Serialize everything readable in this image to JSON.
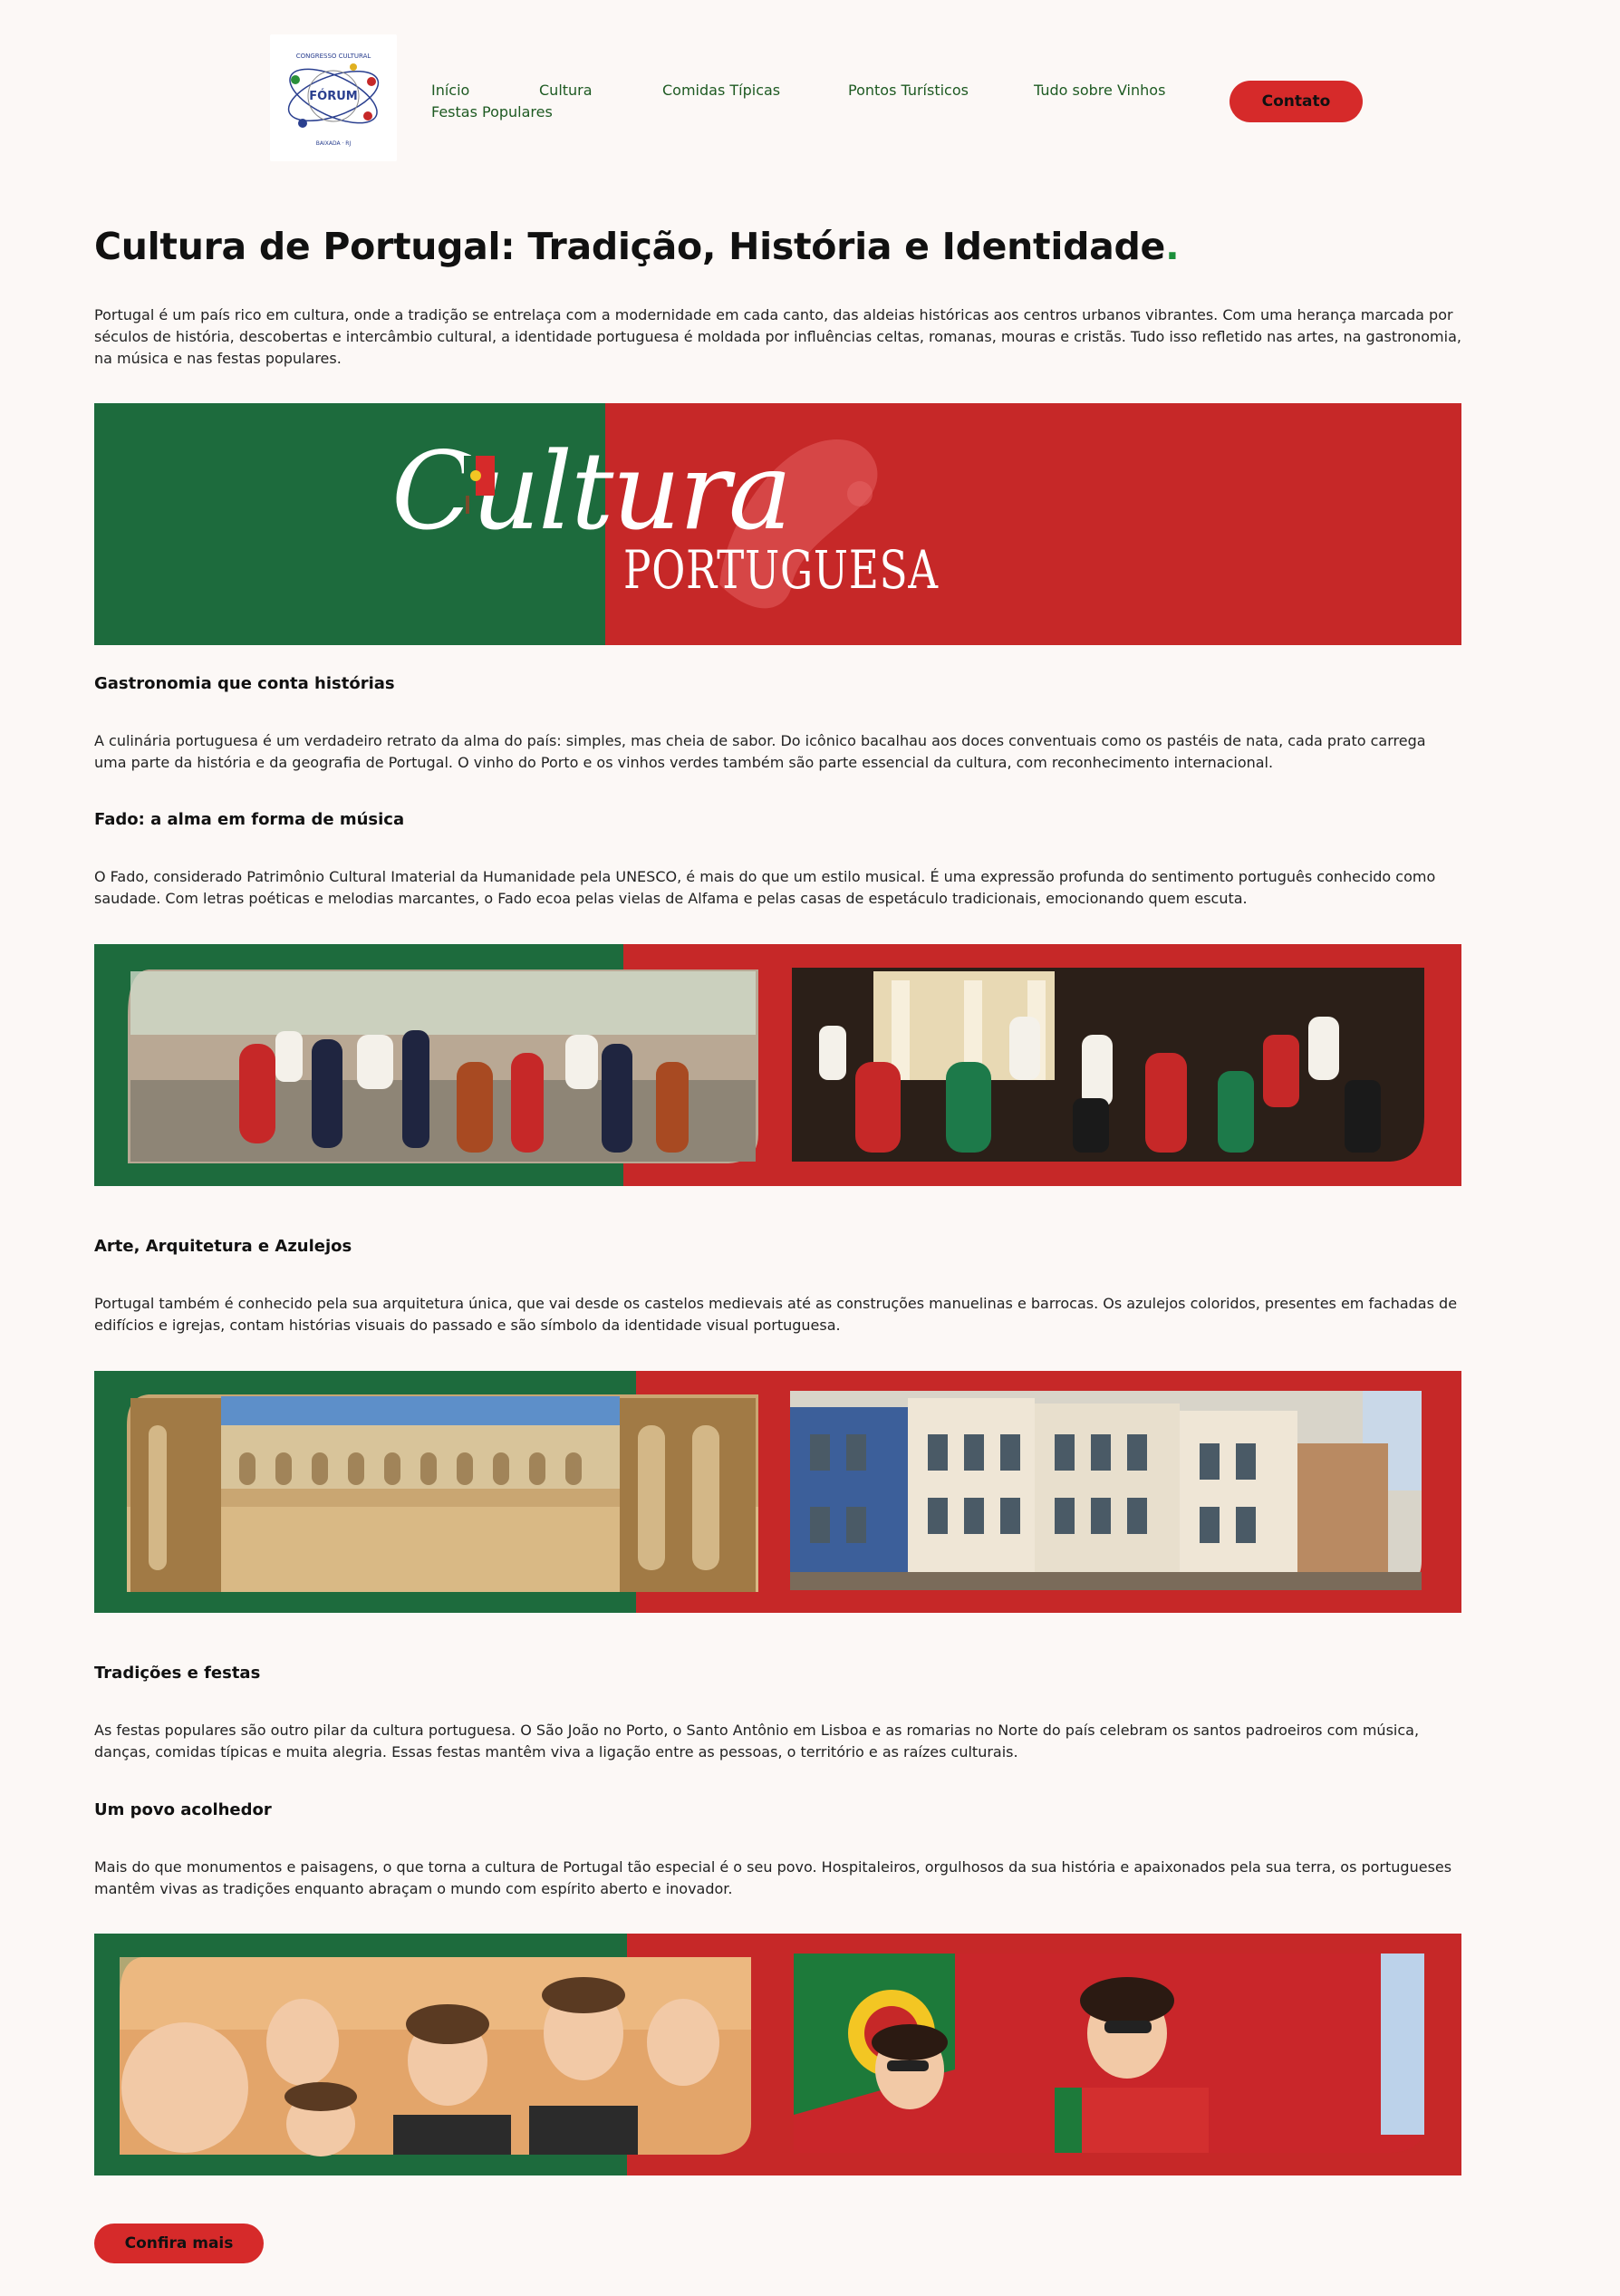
{
  "header": {
    "logo": {
      "org_text": "FÓRUM",
      "org_text_top": "CONGRESSO CULTURAL",
      "org_text_bottom": "BAIXADA · RJ"
    },
    "nav": [
      "Início",
      "Cultura",
      "Comidas Típicas",
      "Pontos Turísticos",
      "Tudo sobre Vinhos",
      "Festas Populares"
    ],
    "contact_label": "Contato"
  },
  "page": {
    "title": "Cultura de Portugal: Tradição, História e Identidade",
    "title_dot": ".",
    "intro": "Portugal é um país rico em cultura, onde a tradição se entrelaça com a modernidade em cada canto, das aldeias históricas aos centros urbanos vibrantes. Com uma herança marcada por séculos de história, descobertas e intercâmbio cultural, a identidade portuguesa é moldada por influências celtas, romanas, mouras e cristãs. Tudo isso refletido nas artes, na gastronomia, na música e nas festas populares."
  },
  "hero_banner": {
    "title": "Cultura",
    "subtitle": "PORTUGUESA",
    "colors": {
      "green": "#1d6b3d",
      "red": "#c62828"
    }
  },
  "sections": [
    {
      "heading": "Gastronomia que conta histórias",
      "text": "A culinária portuguesa é um verdadeiro retrato da alma do país: simples, mas cheia de sabor. Do icônico bacalhau aos doces conventuais como os pastéis de nata, cada prato carrega uma parte da história e da geografia de Portugal. O vinho do Porto e os vinhos verdes também são parte essencial da cultura, com reconhecimento internacional."
    },
    {
      "heading": "Fado: a alma em forma de música",
      "text": "O Fado, considerado Patrimônio Cultural Imaterial da Humanidade pela UNESCO, é mais do que um estilo musical. É uma expressão profunda do sentimento português conhecido como saudade. Com letras poéticas e melodias marcantes, o Fado ecoa pelas vielas de Alfama e pelas casas de espetáculo tradicionais, emocionando quem escuta."
    },
    {
      "heading": "Arte, Arquitetura e Azulejos",
      "text": "Portugal também é conhecido pela sua arquitetura única, que vai desde os castelos medievais até as construções manuelinas e barrocas. Os azulejos coloridos, presentes em fachadas de edifícios e igrejas, contam histórias visuais do passado e são símbolo da identidade visual portuguesa."
    },
    {
      "heading": "Tradições e festas",
      "text": "As festas populares são outro pilar da cultura portuguesa. O São João no Porto, o Santo Antônio em Lisboa e as romarias no Norte do país celebram os santos padroeiros com música, danças, comidas típicas e muita alegria. Essas festas mantêm viva a ligação entre as pessoas, o território e as raízes culturais."
    },
    {
      "heading": "Um povo acolhedor",
      "text": "Mais do que monumentos e paisagens, o que torna a cultura de Portugal tão especial é o seu povo. Hospitaleiros, orgulhosos da sua história e apaixonados pela sua terra, os portugueses mantêm vivas as tradições enquanto abraçam o mundo com espírito aberto e inovador."
    }
  ],
  "cta_label": "Confira mais"
}
